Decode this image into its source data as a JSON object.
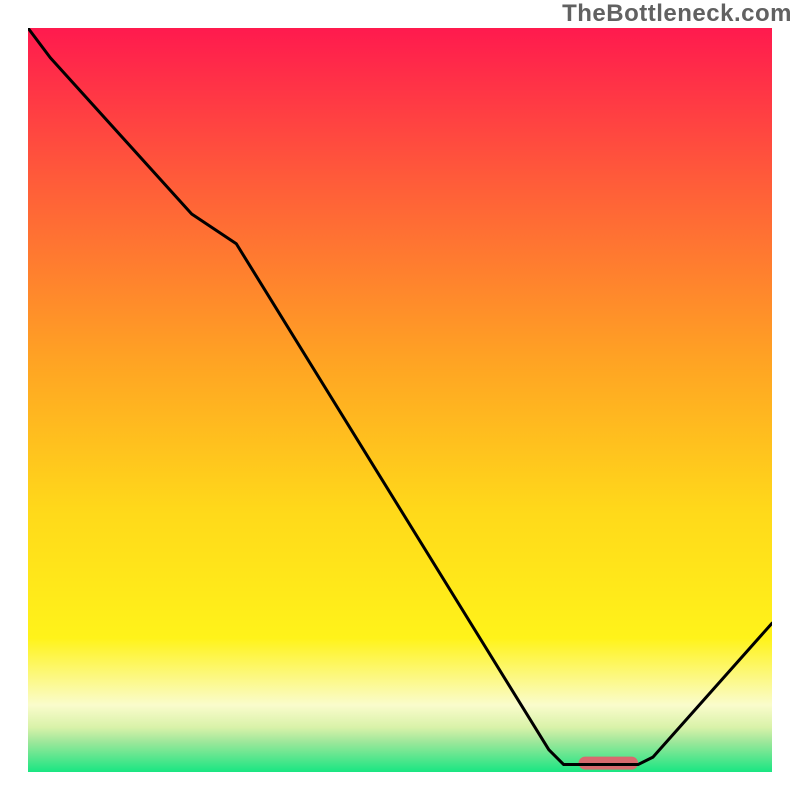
{
  "watermark": "TheBottleneck.com",
  "chart_data": {
    "type": "line",
    "title": "",
    "xlabel": "",
    "ylabel": "",
    "xlim": [
      0,
      100
    ],
    "ylim": [
      0,
      100
    ],
    "grid": false,
    "legend": false,
    "series": [
      {
        "name": "bottleneck-curve",
        "x": [
          0,
          3,
          22,
          28,
          70,
          72,
          82,
          84,
          100
        ],
        "y": [
          100,
          96,
          75,
          71,
          3,
          1,
          1,
          2,
          20
        ]
      }
    ],
    "markers": [
      {
        "name": "optimal-range",
        "shape": "rounded-bar",
        "x_start": 74,
        "x_end": 82,
        "y": 1.2,
        "color": "#d86a6e"
      }
    ],
    "background_gradient": {
      "stops": [
        {
          "y": 100,
          "color": "#ff1a4e"
        },
        {
          "y": 80,
          "color": "#ff5a3a"
        },
        {
          "y": 55,
          "color": "#ffa423"
        },
        {
          "y": 35,
          "color": "#ffd91a"
        },
        {
          "y": 18,
          "color": "#fff31a"
        },
        {
          "y": 9,
          "color": "#fafccc"
        },
        {
          "y": 6,
          "color": "#d9f2a9"
        },
        {
          "y": 4,
          "color": "#9ce79a"
        },
        {
          "y": 0,
          "color": "#19e682"
        }
      ]
    }
  }
}
